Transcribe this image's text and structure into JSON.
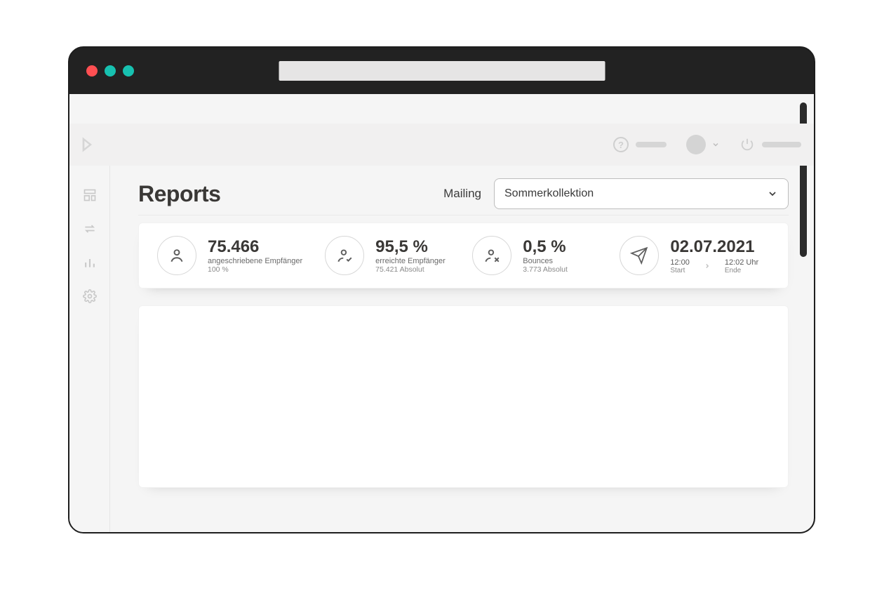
{
  "page": {
    "title": "Reports"
  },
  "mailing": {
    "label": "Mailing",
    "selected": "Sommerkollektion"
  },
  "stats": {
    "recipients": {
      "value": "75.466",
      "label": "angeschriebene Empfänger",
      "sub": "100 %"
    },
    "reached": {
      "value": "95,5 %",
      "label": "erreichte Empfänger",
      "sub": "75.421 Absolut"
    },
    "bounces": {
      "value": "0,5 %",
      "label": "Bounces",
      "sub": "3.773 Absolut"
    },
    "date": {
      "value": "02.07.2021",
      "start_time": "12:00",
      "start_label": "Start",
      "end_time": "12:02 Uhr",
      "end_label": "Ende"
    }
  }
}
